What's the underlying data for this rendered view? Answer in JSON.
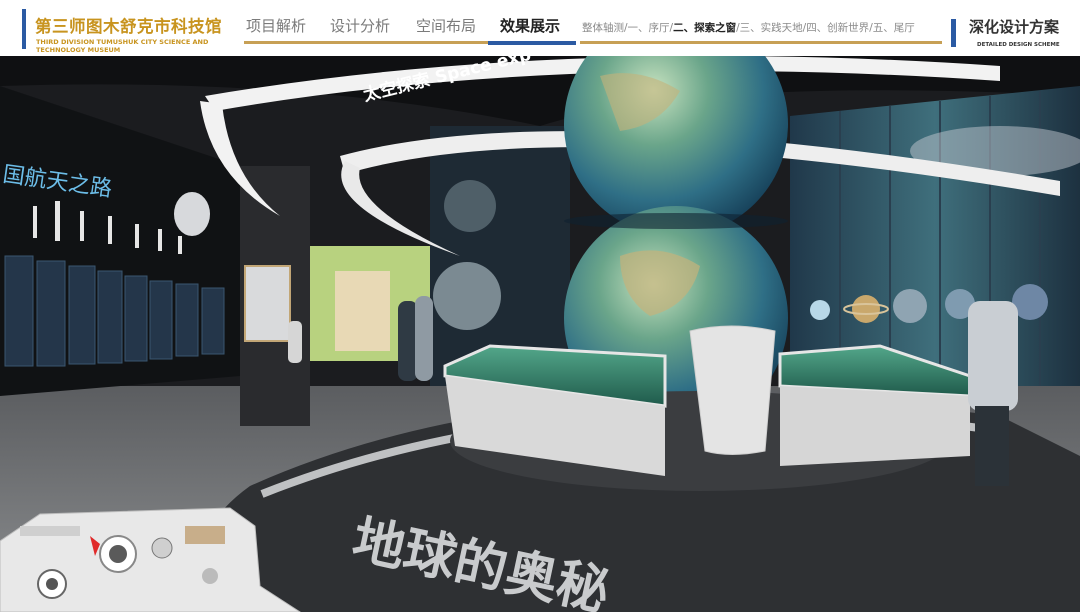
{
  "header": {
    "title": "第三师图木舒克市科技馆",
    "subtitle": "THIRD DIVISION TUMUSHUK CITY SCIENCE AND TECHNOLOGY MUSEUM",
    "nav": [
      {
        "label": "项目解析",
        "active": false
      },
      {
        "label": "设计分析",
        "active": false
      },
      {
        "label": "空间布局",
        "active": false
      },
      {
        "label": "效果展示",
        "active": true
      }
    ],
    "sub_nav": {
      "items": [
        "整体轴测",
        "一、序厅",
        "二、探索之窗",
        "三、实践天地",
        "四、创新世界",
        "五、尾厅"
      ],
      "current_index": 2
    },
    "right_title": "深化设计方案",
    "right_subtitle": "DETAILED DESIGN SCHEME"
  },
  "render": {
    "ceiling_ring_text": "太空探索 Space exp",
    "wall_text": "国航天之路",
    "floor_text": "地球的奥秘"
  },
  "colors": {
    "accent_gold": "#c8941f",
    "accent_blue": "#2b5aa3",
    "underline_gold": "#c7a055"
  }
}
